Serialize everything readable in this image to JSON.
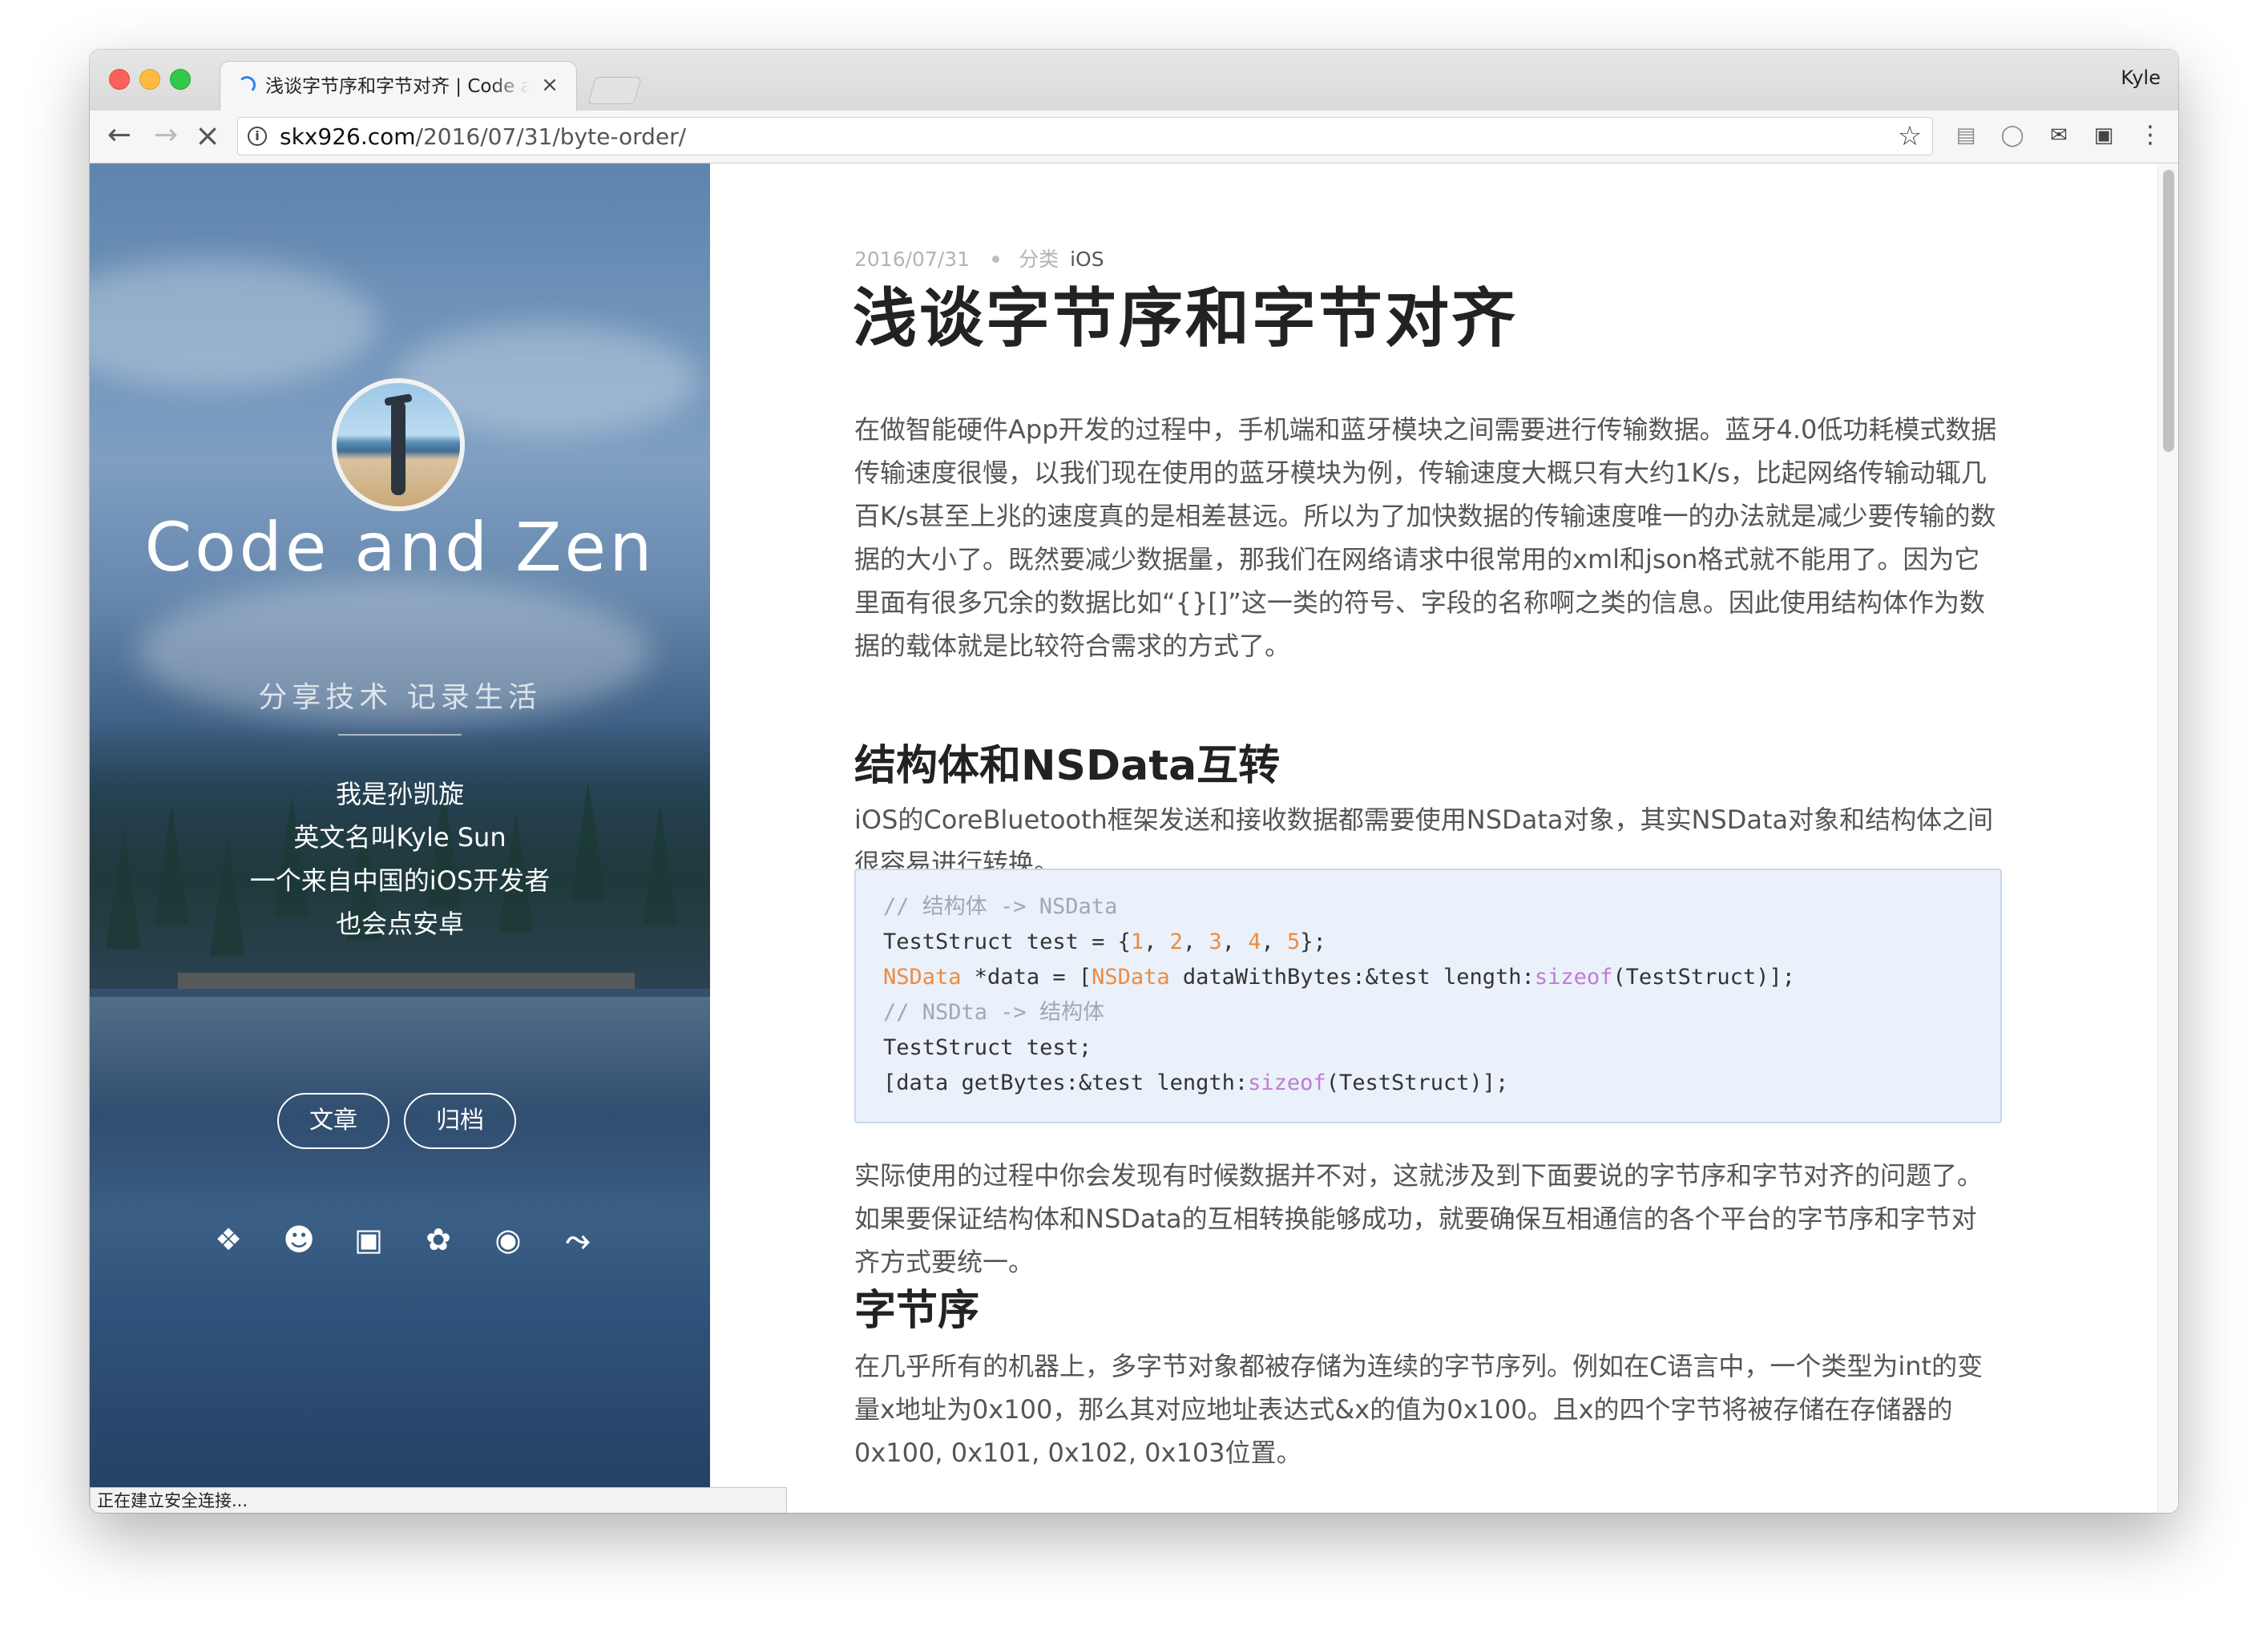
{
  "browser": {
    "tab_title": "浅谈字节序和字节对齐 | Code and Zen",
    "tab_close": "×",
    "profile_name": "Kyle",
    "url_host": "skx926.com",
    "url_path": "/2016/07/31/byte-order/",
    "status_text": "正在建立安全连接..."
  },
  "icons": {
    "back": "back-arrow-icon",
    "forward": "forward-arrow-icon",
    "stop": "stop-loading-icon",
    "info": "info-icon",
    "star": "bookmark-star-icon",
    "extensions": [
      "reader-icon",
      "shield-icon",
      "mail-icon",
      "badge-icon",
      "menu-dots-icon"
    ],
    "social": [
      "weibo-icon",
      "github-icon",
      "google-plus-icon",
      "twitter-icon",
      "instagram-icon",
      "rss-icon"
    ]
  },
  "sidebar": {
    "title": "Code and Zen",
    "subtitle": "分享技术 记录生活",
    "bio": [
      "我是孙凯旋",
      "英文名叫Kyle Sun",
      "一个来自中国的iOS开发者",
      "也会点安卓"
    ],
    "buttons": {
      "articles": "文章",
      "archives": "归档"
    }
  },
  "post": {
    "date": "2016/07/31",
    "category_label": "分类",
    "category": "iOS",
    "title": "浅谈字节序和字节对齐",
    "intro": "在做智能硬件App开发的过程中，手机端和蓝牙模块之间需要进行传输数据。蓝牙4.0低功耗模式数据传输速度很慢，以我们现在使用的蓝牙模块为例，传输速度大概只有大约1K/s，比起网络传输动辄几百K/s甚至上兆的速度真的是相差甚远。所以为了加快数据的传输速度唯一的办法就是减少要传输的数据的大小了。既然要减少数据量，那我们在网络请求中很常用的xml和json格式就不能用了。因为它里面有很多冗余的数据比如“{}[]”这一类的符号、字段的名称啊之类的信息。因此使用结构体作为数据的载体就是比较符合需求的方式了。",
    "h2_struct": "结构体和NSData互转",
    "struct_para": "iOS的CoreBluetooth框架发送和接收数据都需要使用NSData对象，其实NSData对象和结构体之间很容易进行转换。",
    "code": {
      "comment1": "// 结构体 -> NSData",
      "line2_a": "TestStruct test = {",
      "n1": "1",
      "n2": "2",
      "n3": "3",
      "n4": "4",
      "n5": "5",
      "sep": ", ",
      "line2_end": "};",
      "type_nsdata": "NSData",
      "line3_b": " *data = [",
      "line3_d": " dataWithBytes:&test length:",
      "kw_sizeof": "sizeof",
      "line3_f": "(TestStruct)];",
      "comment2": "// NSDta -> 结构体",
      "line5": "TestStruct test;",
      "line6_a": "[data getBytes:&test length:",
      "line6_c": "(TestStruct)];"
    },
    "after_code_para": "实际使用的过程中你会发现有时候数据并不对，这就涉及到下面要说的字节序和字节对齐的问题了。如果要保证结构体和NSData的互相转换能够成功，就要确保互相通信的各个平台的字节序和字节对齐方式要统一。",
    "h2_byte_order": "字节序",
    "byte_order_para": "在几乎所有的机器上，多字节对象都被存储为连续的字节序列。例如在C语言中，一个类型为int的变量x地址为0x100，那么其对应地址表达式&x的值为0x100。且x的四个字节将被存储在存储器的0x100, 0x101, 0x102, 0x103位置。"
  }
}
